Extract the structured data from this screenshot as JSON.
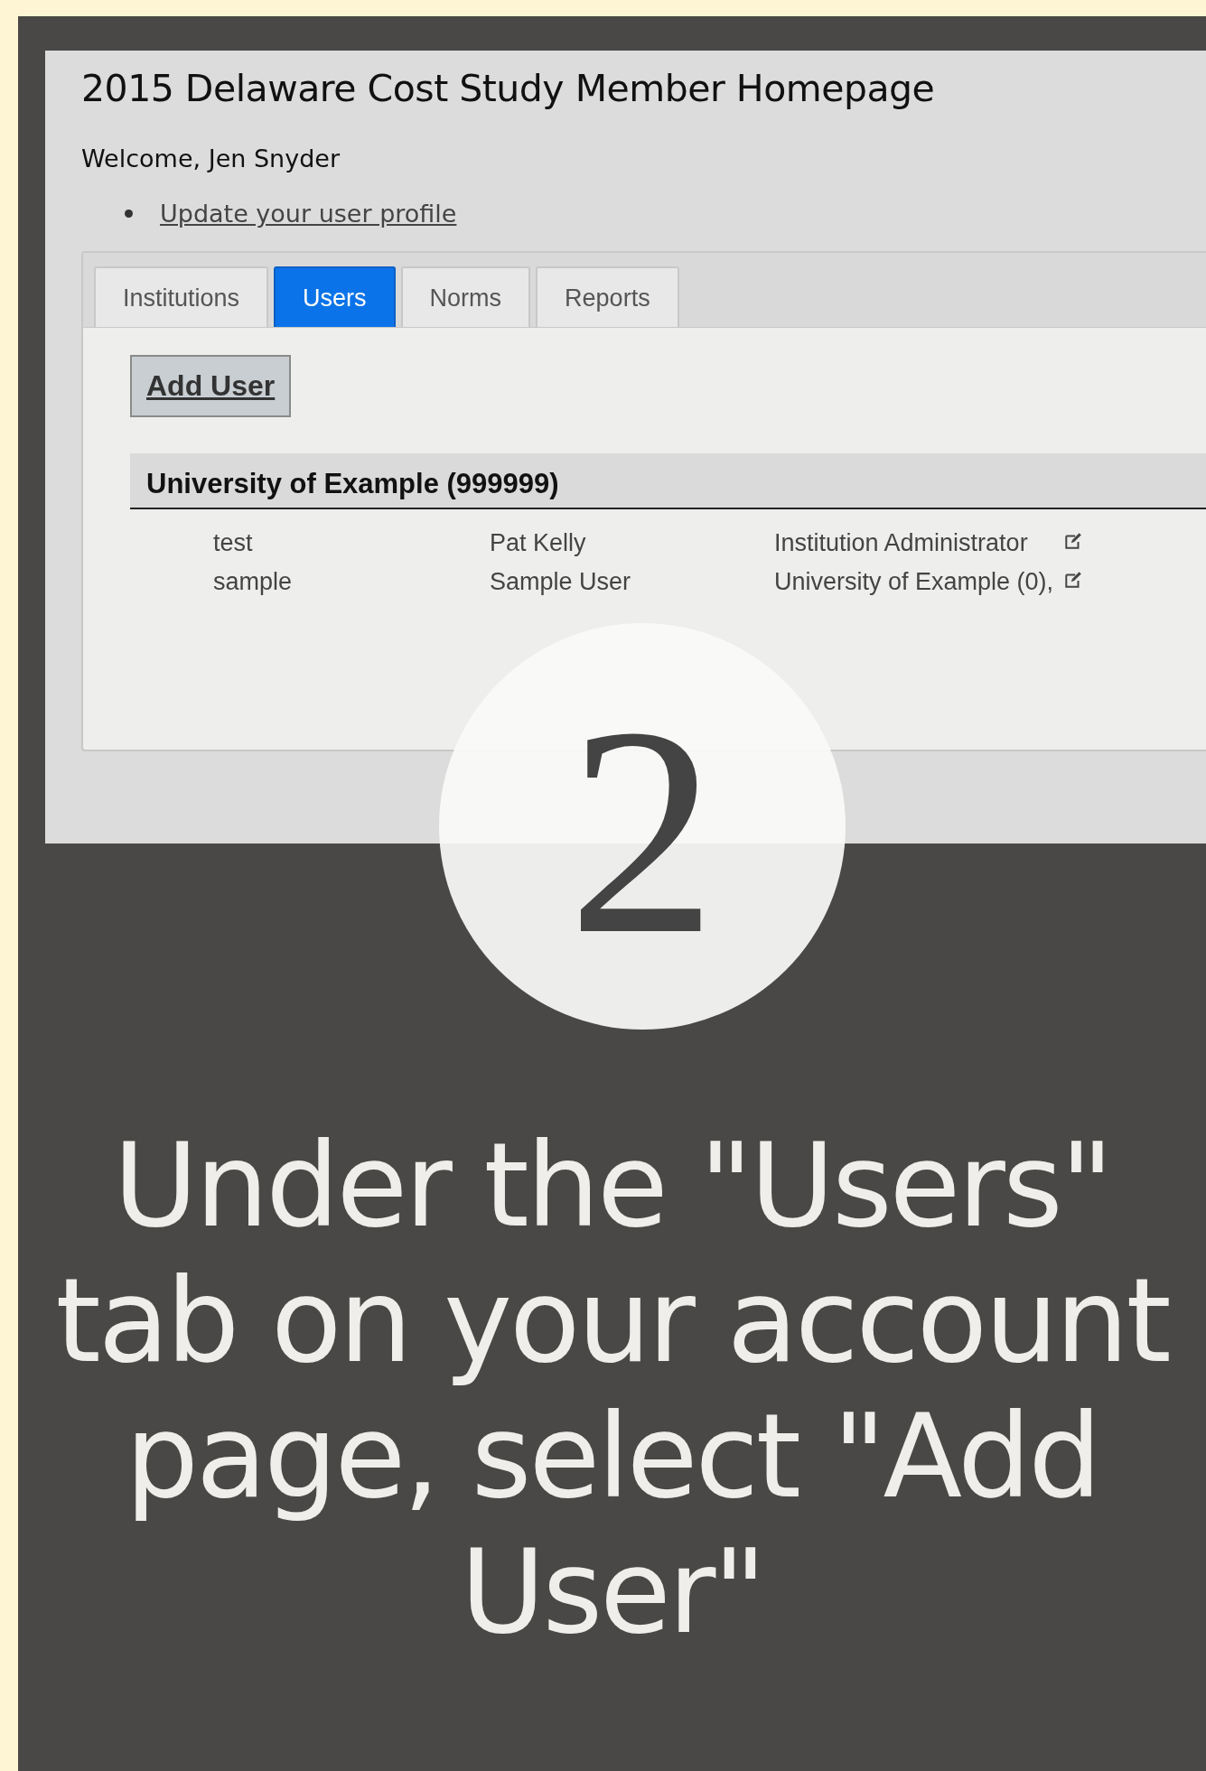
{
  "page": {
    "title": "2015 Delaware Cost Study Member Homepage",
    "welcome": "Welcome, Jen Snyder",
    "links": [
      "Update your user profile"
    ]
  },
  "tabs": [
    {
      "label": "Institutions",
      "selected": false
    },
    {
      "label": "Users",
      "selected": true
    },
    {
      "label": "Norms",
      "selected": false
    },
    {
      "label": "Reports",
      "selected": false
    }
  ],
  "add_button": "Add User",
  "group": {
    "title": "University of Example (999999)",
    "rows": [
      {
        "username": "test",
        "name": "Pat Kelly",
        "role": "Institution Administrator"
      },
      {
        "username": "sample",
        "name": "Sample User",
        "role": "University of Example (0),"
      }
    ]
  },
  "step": {
    "number": "2",
    "caption": "Under the \"Users\" tab on your account page, select \"Add User\""
  }
}
